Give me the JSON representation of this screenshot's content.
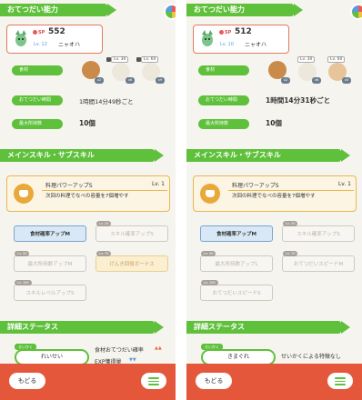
{
  "panels": [
    {
      "header_ability": "おてつだい能力",
      "sp_label": "SP",
      "sp_value": "552",
      "level": "Lv. 12",
      "name": "ニャオハ",
      "ingredient_label": "食材",
      "ingredient_lv": [
        "Lv. 30",
        "Lv. 60"
      ],
      "ingredient_counts": [
        "x2",
        "x6",
        "x9"
      ],
      "help_time_label": "おてつだい時間",
      "help_time_value": "1時間14分49秒ごと",
      "max_carry_label": "最大所持数",
      "max_carry_value": "10個",
      "header_skill": "メインスキル・サブスキル",
      "skill_name": "料理パワーアップS",
      "skill_level": "Lv. 1",
      "skill_desc": "次回の料理でなべの容量を7個増やす",
      "subskills": [
        {
          "label": "食材確率アップM",
          "lv": ""
        },
        {
          "label": "スキル確率アップS",
          "lv": "Lv. 25"
        },
        {
          "label": "最大所持数アップM",
          "lv": "Lv. 50"
        },
        {
          "label": "げんき回復ボーナス",
          "lv": "Lv. 75"
        },
        {
          "label": "スキルレベルアップS",
          "lv": "Lv. 100"
        }
      ],
      "header_detail": "詳細ステータス",
      "nature_tag": "せいかく",
      "nature_value": "れいせい",
      "nature_up": "食材おてつだい確率",
      "nature_down": "EXP獲得量",
      "back": "もどる"
    },
    {
      "header_ability": "おてつだい能力",
      "sp_label": "SP",
      "sp_value": "512",
      "level": "Lv. 10",
      "name": "ニャオハ",
      "ingredient_label": "食材",
      "ingredient_lv": [
        "Lv. 30",
        "Lv. 60"
      ],
      "ingredient_counts": [
        "x2",
        "x6",
        "x5"
      ],
      "help_time_label": "おてつだい時間",
      "help_time_value": "1時間14分31秒ごと",
      "max_carry_label": "最大所持数",
      "max_carry_value": "10個",
      "header_skill": "メインスキル・サブスキル",
      "skill_name": "料理パワーアップS",
      "skill_level": "Lv. 1",
      "skill_desc": "次回の料理でなべの容量を7個増やす",
      "subskills": [
        {
          "label": "食材確率アップM",
          "lv": ""
        },
        {
          "label": "スキル確率アップS",
          "lv": "Lv. 25"
        },
        {
          "label": "最大所持数アップL",
          "lv": "Lv. 50"
        },
        {
          "label": "おてつだいスピードM",
          "lv": "Lv. 75"
        },
        {
          "label": "おてつだいスピードS",
          "lv": "Lv. 100"
        }
      ],
      "header_detail": "詳細ステータス",
      "nature_tag": "せいかく",
      "nature_value": "きまぐれ",
      "nature_none": "せいかくによる特徴なし",
      "back": "もどる"
    }
  ],
  "colors": {
    "green": "#5ec03b",
    "orange": "#e4573a",
    "gold": "#e8b650",
    "blue": "#7ba4cf"
  }
}
